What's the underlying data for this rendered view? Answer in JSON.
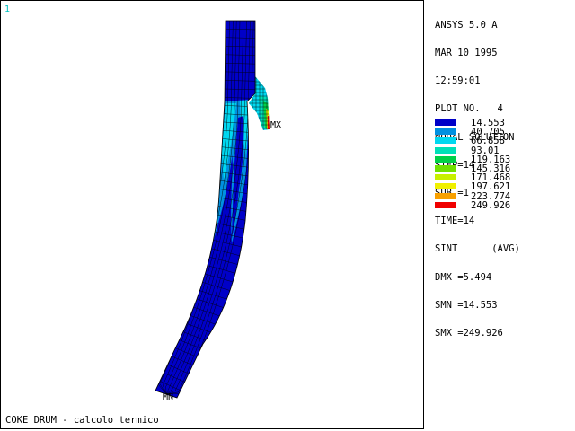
{
  "window_number": "1",
  "info": {
    "product": "ANSYS 5.0 A",
    "date": "MAR 10 1995",
    "time": "12:59:01",
    "plot_no": "PLOT NO.   4",
    "solution": "NODAL SOLUTION",
    "step": "STEP=14",
    "sub": "SUB =1",
    "time_value": "TIME=14",
    "sint": "SINT      (AVG)",
    "dmx": "DMX =5.494",
    "smn": "SMN =14.553",
    "smx": "SMX =249.926"
  },
  "legend": [
    {
      "value": "14.553",
      "color": "#0000c8"
    },
    {
      "value": "40.705",
      "color": "#0090e0"
    },
    {
      "value": "66.858",
      "color": "#00d8f0"
    },
    {
      "value": "93.01",
      "color": "#00e0b8"
    },
    {
      "value": "119.163",
      "color": "#00d048"
    },
    {
      "value": "145.316",
      "color": "#70e000"
    },
    {
      "value": "171.468",
      "color": "#c8f000"
    },
    {
      "value": "197.621",
      "color": "#f0f000"
    },
    {
      "value": "223.774",
      "color": "#f8a000"
    },
    {
      "value": "249.926",
      "color": "#f00000"
    }
  ],
  "labels": {
    "max_marker": "MX",
    "min_marker": "MN"
  },
  "footer_title": "COKE DRUM - calcolo termico"
}
